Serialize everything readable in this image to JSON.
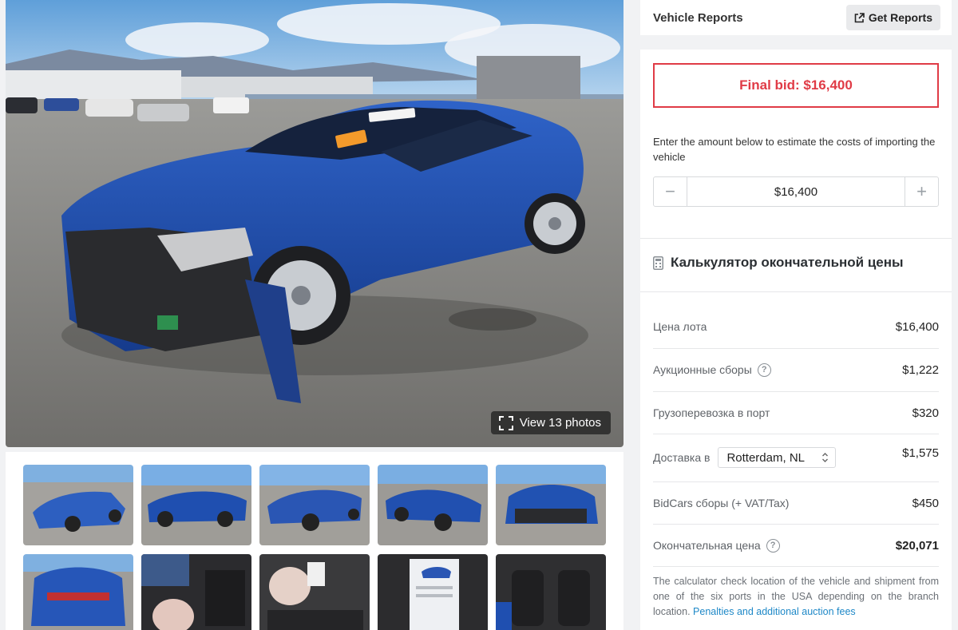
{
  "gallery": {
    "view_photos_label": "View 13 photos",
    "main_photo_subject": "damaged-blue-sedan"
  },
  "reports": {
    "title": "Vehicle Reports",
    "button_label": "Get Reports"
  },
  "bid": {
    "final_bid": "Final bid: $16,400",
    "estimate_text": "Enter the amount below to estimate the costs of importing the vehicle",
    "amount": "$16,400",
    "minus": "−",
    "plus": "+"
  },
  "calculator": {
    "heading": "Калькулятор окончательной цены",
    "rows": [
      {
        "label": "Цена лота",
        "value": "$16,400"
      },
      {
        "label": "Аукционные сборы",
        "value": "$1,222"
      },
      {
        "label": "Грузоперевозка в порт",
        "value": "$320"
      },
      {
        "label": "Доставка в",
        "value": "$1,575",
        "select": "Rotterdam, NL"
      },
      {
        "label": "BidCars сборы (+ VAT/Tax)",
        "value": "$450"
      },
      {
        "label": "Окончательная цена",
        "value": "$20,071"
      }
    ],
    "note": "The calculator check location of the vehicle and shipment from one of the six ports in the USA depending on the branch location.",
    "note_link": "Penalties and additional auction fees"
  },
  "colors": {
    "accent_red": "#e03b46",
    "link_blue": "#1e88c7",
    "car_blue": "#1f4fb0"
  }
}
